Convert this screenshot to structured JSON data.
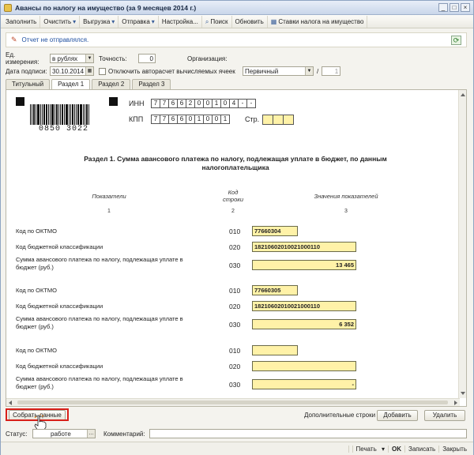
{
  "window": {
    "title": "Авансы по налогу на имущество (за 9 месяцев 2014 г.)"
  },
  "toolbar": {
    "fill": "Заполнить",
    "clear": "Очистить",
    "export": "Выгрузка",
    "send": "Отправка",
    "settings": "Настройка...",
    "search": "Поиск",
    "update": "Обновить",
    "rates": "Ставки налога на имущество"
  },
  "notice": {
    "text": "Отчет не отправлялся."
  },
  "params": {
    "unit_label": "Ед. измерения:",
    "unit_value": "в рублях",
    "precision_label": "Точность:",
    "precision_value": "0",
    "org_label": "Организация:",
    "date_label": "Дата подписи:",
    "date_value": "30.10.2014",
    "autocalc_label": "Отключить авторасчет вычисляемых ячеек",
    "doc_type": "Первичный",
    "corr_num": "1"
  },
  "tabs": [
    "Титульный",
    "Раздел 1",
    "Раздел 2",
    "Раздел 3"
  ],
  "form": {
    "barcode_number": "0850 3022",
    "inn_label": "ИНН",
    "inn_digits": [
      "7",
      "7",
      "6",
      "6",
      "2",
      "0",
      "0",
      "1",
      "0",
      "4",
      "-",
      "-"
    ],
    "kpp_label": "КПП",
    "kpp_digits": [
      "7",
      "7",
      "6",
      "6",
      "0",
      "1",
      "0",
      "0",
      "1"
    ],
    "page_label": "Стр.",
    "heading": "Раздел 1. Сумма авансового платежа по налогу, подлежащая уплате в бюджет, по данным налогоплательщика",
    "col_indicators": "Показатели",
    "col_code": "Код строки",
    "col_values": "Значения показателей",
    "col_num1": "1",
    "col_num2": "2",
    "col_num3": "3",
    "rows": [
      {
        "label": "Код по ОКТМО",
        "code": "010",
        "value": "77660304"
      },
      {
        "label": "Код бюджетной классификации",
        "code": "020",
        "value": "18210602010021000110"
      },
      {
        "label": "Сумма авансового платежа по налогу, подлежащая уплате в бюджет (руб.)",
        "code": "030",
        "value": "13 465"
      },
      {
        "label": "Код по ОКТМО",
        "code": "010",
        "value": "77660305"
      },
      {
        "label": "Код бюджетной классификации",
        "code": "020",
        "value": "18210602010021000110"
      },
      {
        "label": "Сумма авансового платежа по налогу, подлежащая уплате в бюджет (руб.)",
        "code": "030",
        "value": "6 352"
      },
      {
        "label": "Код по ОКТМО",
        "code": "010",
        "value": ""
      },
      {
        "label": "Код бюджетной классификации",
        "code": "020",
        "value": ""
      },
      {
        "label": "Сумма авансового платежа по налогу, подлежащая уплате в бюджет (руб.)",
        "code": "030",
        "value": "-"
      }
    ]
  },
  "bottom": {
    "collect": "Собрать данные",
    "extra_rows": "Дополнительные строки",
    "add": "Добавить",
    "delete": "Удалить"
  },
  "status": {
    "label": "Статус:",
    "value": "работе",
    "comment_label": "Комментарий:"
  },
  "footer": {
    "print": "Печать",
    "ok": "OK",
    "save": "Записать",
    "close": "Закрыть"
  }
}
